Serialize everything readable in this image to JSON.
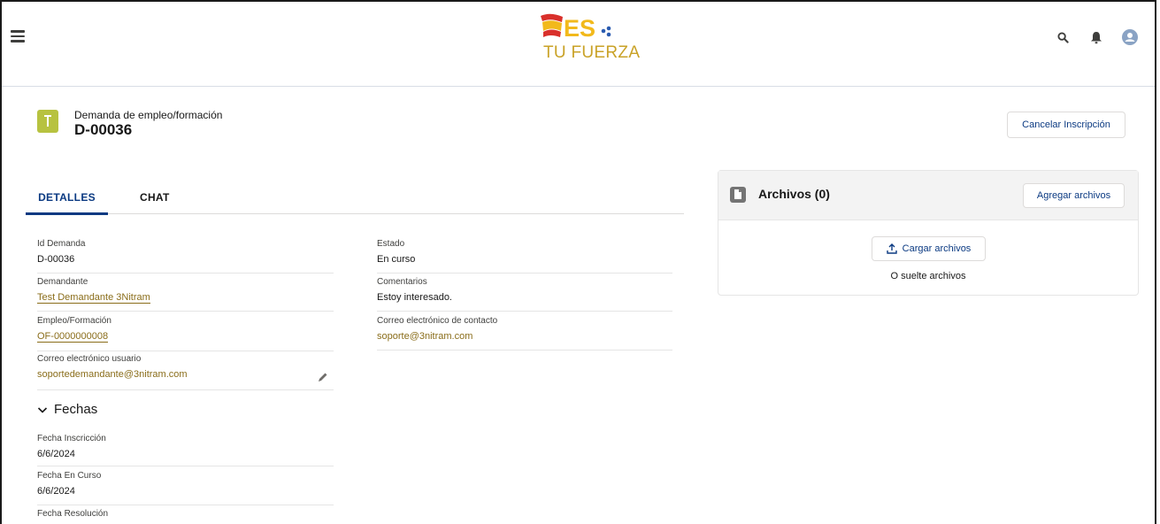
{
  "app": {
    "logo_text": "ES",
    "logo_sub": "TU FUERZA"
  },
  "header_icons": [
    "search-icon",
    "bell-icon",
    "user-avatar-icon"
  ],
  "record": {
    "object_label": "Demanda de empleo/formación",
    "name": "D-00036",
    "cancel_label": "Cancelar Inscripción"
  },
  "tabs": [
    {
      "label": "DETALLES",
      "active": true
    },
    {
      "label": "CHAT",
      "active": false
    }
  ],
  "fields": {
    "id_demanda": {
      "label": "Id Demanda",
      "value": "D-00036"
    },
    "estado": {
      "label": "Estado",
      "value": "En curso"
    },
    "demandante": {
      "label": "Demandante",
      "value": "Test Demandante 3Nitram"
    },
    "comentarios": {
      "label": "Comentarios",
      "value": "Estoy interesado."
    },
    "empleo": {
      "label": "Empleo/Formación",
      "value": "OF-0000000008"
    },
    "correo_contacto": {
      "label": "Correo electrónico de contacto",
      "value": "soporte@3nitram.com"
    },
    "correo_usuario": {
      "label": "Correo electrónico usuario",
      "value": "soportedemandante@3nitram.com"
    }
  },
  "section_fechas": {
    "title": "Fechas",
    "fields": [
      {
        "label": "Fecha Inscricción",
        "value": "6/6/2024"
      },
      {
        "label": "Fecha En Curso",
        "value": "6/6/2024"
      },
      {
        "label": "Fecha Resolución",
        "value": ""
      }
    ]
  },
  "files": {
    "title": "Archivos (0)",
    "add_label": "Agregar archivos",
    "upload_label": "Cargar archivos",
    "drop_text": "O suelte archivos"
  },
  "colors": {
    "brand_blue": "#0b3a82",
    "link_gold": "#8a6d1a",
    "record_icon": "#b7c240"
  }
}
